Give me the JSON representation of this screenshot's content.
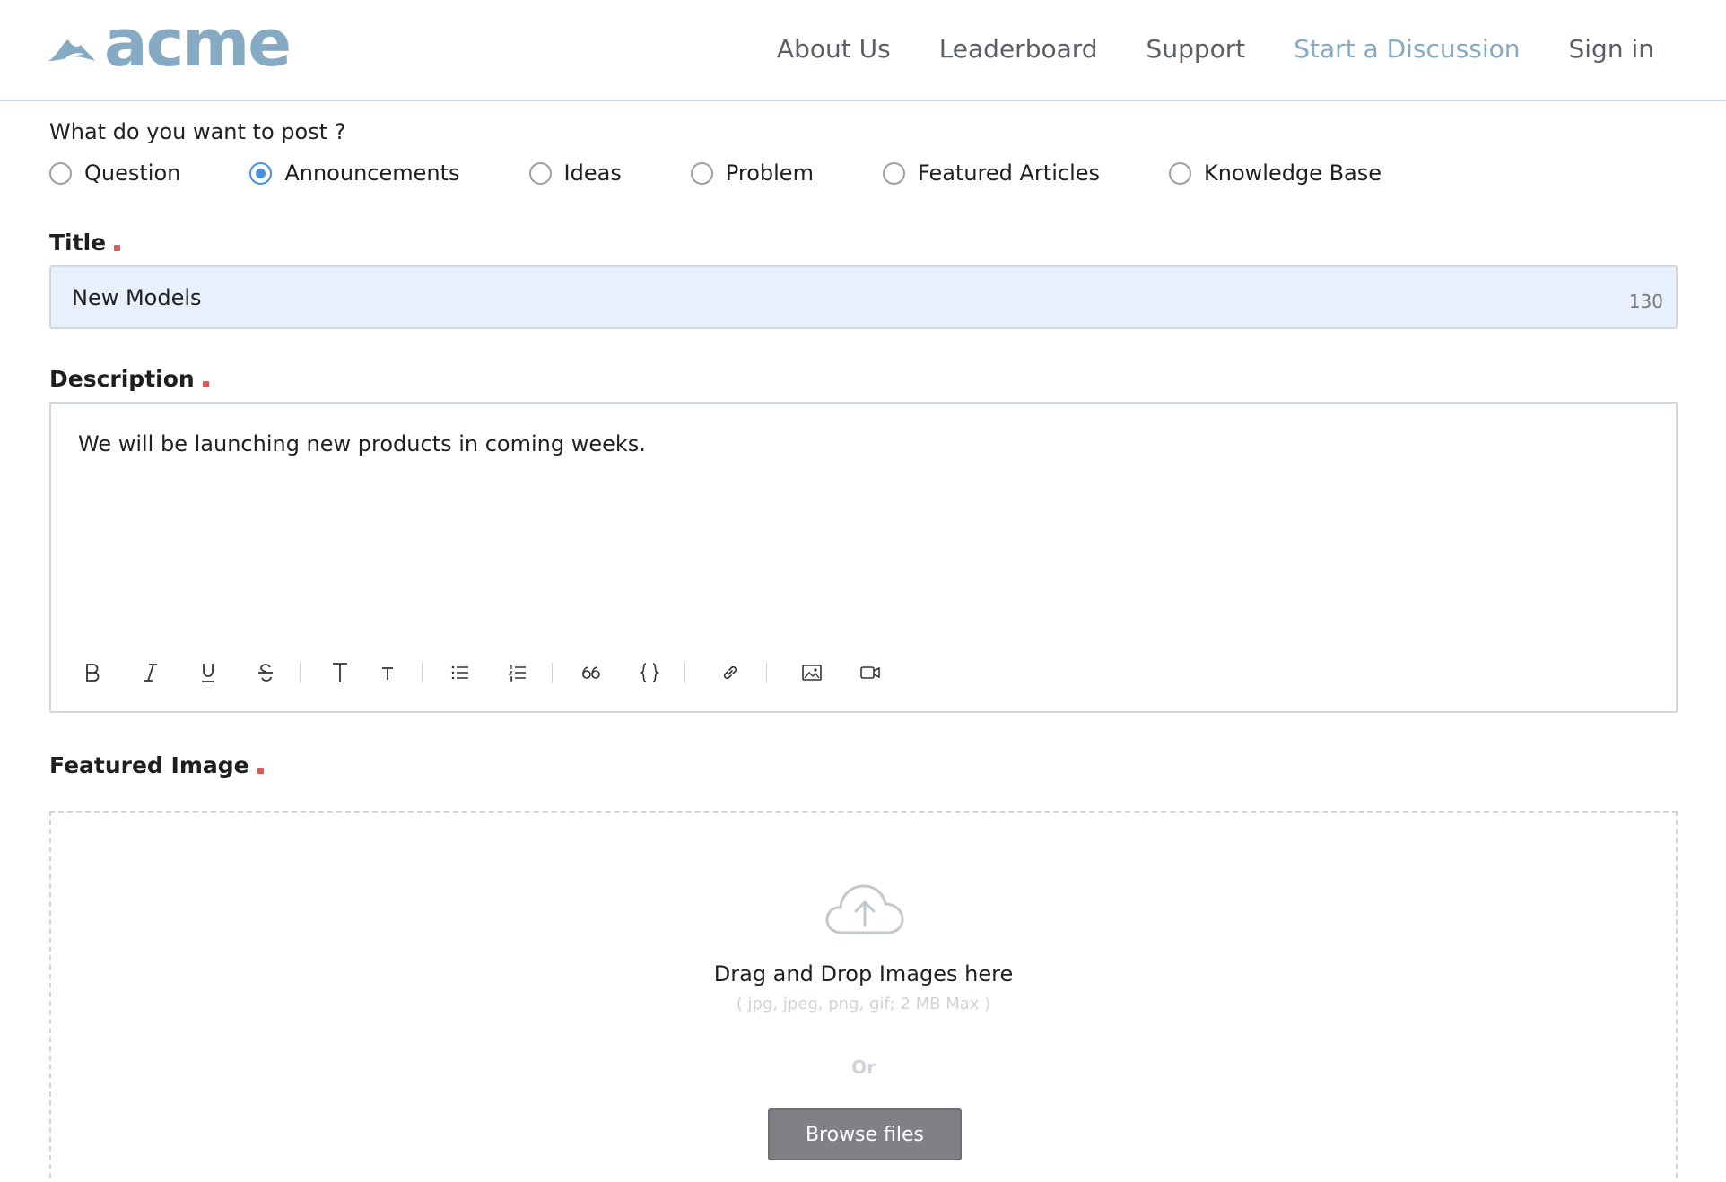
{
  "brand": {
    "name": "acme",
    "color": "#86a9c4"
  },
  "nav": {
    "items": [
      {
        "label": "About Us",
        "active": false
      },
      {
        "label": "Leaderboard",
        "active": false
      },
      {
        "label": "Support",
        "active": false
      },
      {
        "label": "Start a Discussion",
        "active": true
      },
      {
        "label": "Sign in",
        "active": false
      }
    ]
  },
  "post_type": {
    "question": "What do you want to post ?",
    "options": [
      {
        "label": "Question",
        "selected": false
      },
      {
        "label": "Announcements",
        "selected": true
      },
      {
        "label": "Ideas",
        "selected": false
      },
      {
        "label": "Problem",
        "selected": false
      },
      {
        "label": "Featured Articles",
        "selected": false
      },
      {
        "label": "Knowledge Base",
        "selected": false
      }
    ]
  },
  "title_field": {
    "label": "Title",
    "value": "New Models",
    "char_count": "130"
  },
  "description_field": {
    "label": "Description",
    "value": "We will be launching new products in coming weeks.",
    "toolbar": [
      "bold-icon",
      "italic-icon",
      "underline-icon",
      "strikethrough-icon",
      "heading-large-icon",
      "heading-small-icon",
      "bullet-list-icon",
      "numbered-list-icon",
      "quote-icon",
      "code-icon",
      "link-icon",
      "image-icon",
      "video-icon"
    ]
  },
  "featured_image": {
    "label": "Featured Image",
    "dropzone_title": "Drag and Drop Images here",
    "dropzone_hint": "( jpg, jpeg, png, gif; 2 MB Max )",
    "or_text": "Or",
    "browse_label": "Browse files"
  },
  "colors": {
    "accent": "#86a9c4",
    "radio_selected": "#4a90e2",
    "required": "#e05555",
    "input_bg": "#e8f0fe"
  }
}
